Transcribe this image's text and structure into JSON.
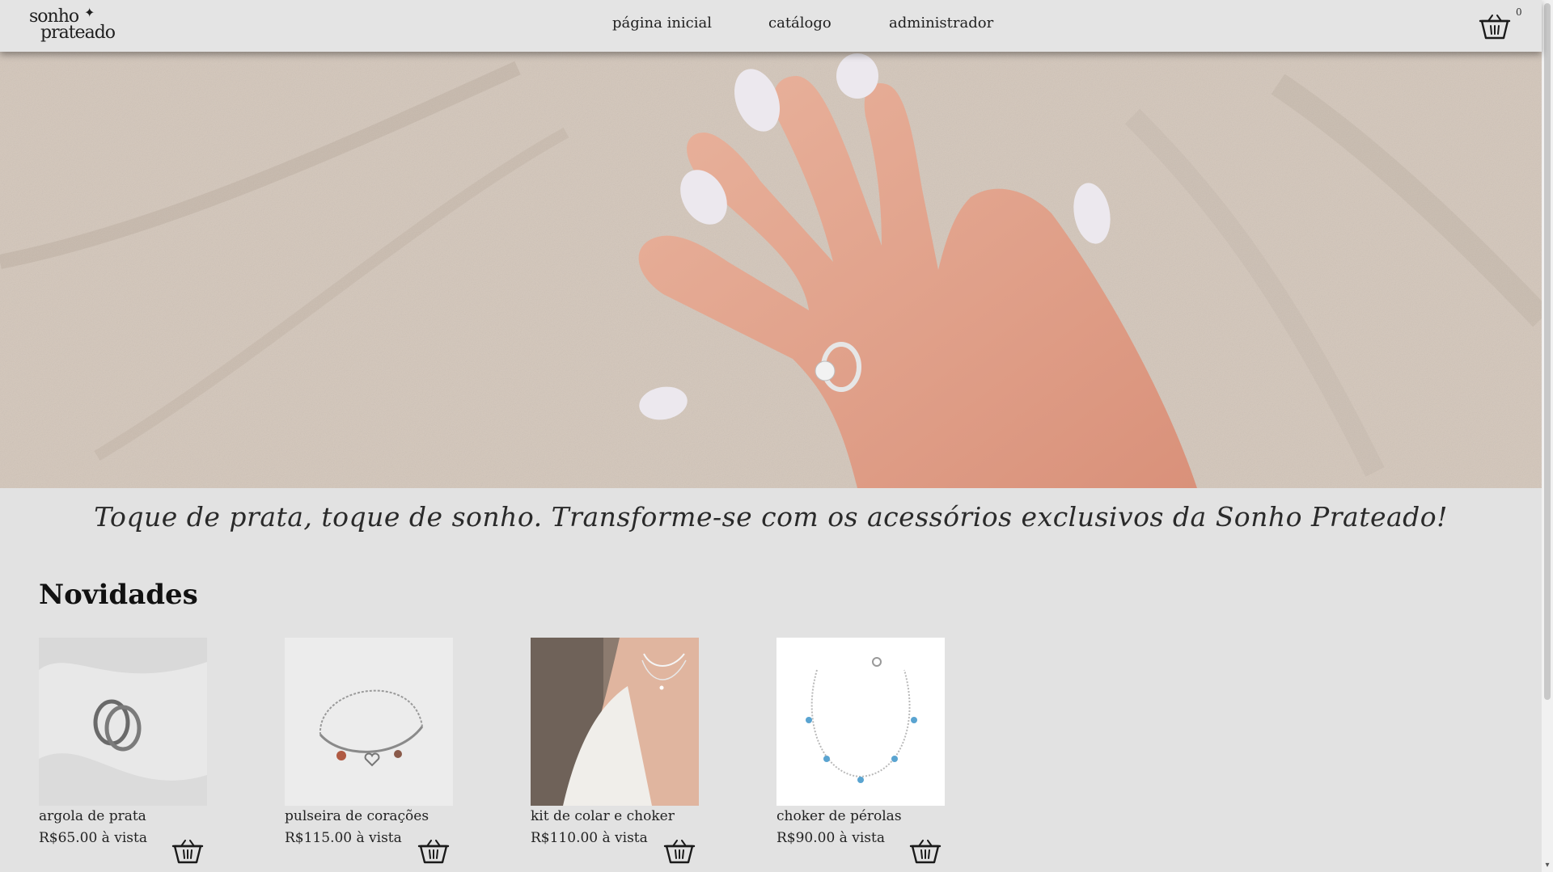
{
  "brand": {
    "logo_line1": "sonho",
    "logo_line2": "prateado",
    "logo_spark": "✦"
  },
  "nav": {
    "items": [
      {
        "label": "página inicial"
      },
      {
        "label": "catálogo"
      },
      {
        "label": "administrador"
      }
    ],
    "cart_icon": "basket-icon",
    "cart_count": "0"
  },
  "hero": {
    "image": "hand-with-ring-on-sand"
  },
  "tagline": "Toque de prata, toque de sonho. Transforme-se com os acessórios exclusivos da Sonho Prateado!",
  "section": {
    "title": "Novidades"
  },
  "products": [
    {
      "name": "argola de prata",
      "price": "R$65.00 à vista",
      "image": "silver-rings"
    },
    {
      "name": "pulseira de corações",
      "price": "R$115.00 à vista",
      "image": "heart-bracelet"
    },
    {
      "name": "kit de colar e choker",
      "price": "R$110.00 à vista",
      "image": "necklace-choker-model"
    },
    {
      "name": "choker de pérolas",
      "price": "R$90.00 à vista",
      "image": "bracelet-blue-stones"
    }
  ],
  "colors": {
    "background": "#e2e2e2",
    "header": "#e4e4e4",
    "text": "#1a1a1a"
  }
}
